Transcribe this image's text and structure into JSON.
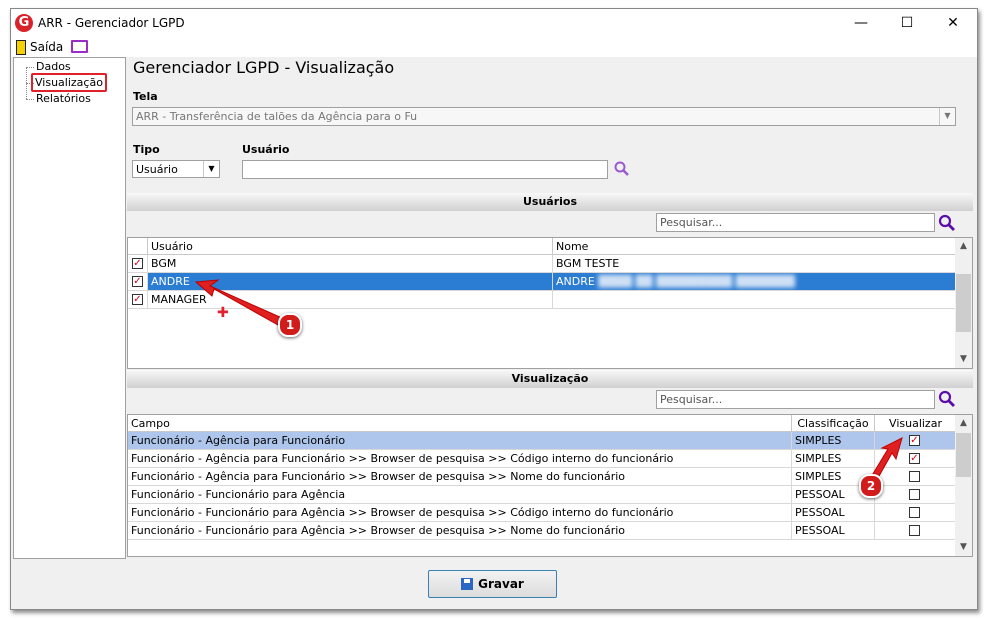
{
  "window": {
    "title": "ARR - Gerenciador LGPD",
    "minimize": "—",
    "maximize": "☐",
    "close": "✕",
    "logo": "G"
  },
  "menu": {
    "exit_label": "Saída"
  },
  "tree": {
    "items": [
      {
        "label": "Dados"
      },
      {
        "label": "Visualização",
        "selected": true
      },
      {
        "label": "Relatórios"
      }
    ]
  },
  "page": {
    "title": "Gerenciador LGPD - Visualização"
  },
  "tela": {
    "label": "Tela",
    "value": "ARR - Transferência de talões da Agência para o Fu"
  },
  "tipo": {
    "label": "Tipo",
    "value": "Usuário"
  },
  "usuario_filter": {
    "label": "Usuário",
    "value": ""
  },
  "usuarios": {
    "header": "Usuários",
    "search_placeholder": "Pesquisar...",
    "columns": [
      "Usuário",
      "Nome"
    ],
    "rows": [
      {
        "checked": true,
        "usuario": "BGM",
        "nome": "BGM TESTE"
      },
      {
        "checked": true,
        "usuario": "ANDRE",
        "nome": "ANDRE",
        "selected": true
      },
      {
        "checked": true,
        "usuario": "MANAGER",
        "nome": ""
      }
    ]
  },
  "visualizacao": {
    "header": "Visualização",
    "search_placeholder": "Pesquisar...",
    "columns": [
      "Campo",
      "Classificação",
      "Visualizar"
    ],
    "rows": [
      {
        "campo": "Funcionário - Agência para Funcionário",
        "classificacao": "SIMPLES",
        "visualizar": true,
        "selected": true
      },
      {
        "campo": "Funcionário - Agência para Funcionário >> Browser de pesquisa >> Código interno do funcionário",
        "classificacao": "SIMPLES",
        "visualizar": true
      },
      {
        "campo": "Funcionário - Agência para Funcionário >> Browser de pesquisa >> Nome do funcionário",
        "classificacao": "SIMPLES",
        "visualizar": false
      },
      {
        "campo": "Funcionário - Funcionário para Agência",
        "classificacao": "PESSOAL",
        "visualizar": false
      },
      {
        "campo": "Funcionário - Funcionário para Agência >> Browser de pesquisa >> Código interno do funcionário",
        "classificacao": "PESSOAL",
        "visualizar": false
      },
      {
        "campo": "Funcionário - Funcionário para Agência >> Browser de pesquisa >> Nome do funcionário",
        "classificacao": "PESSOAL",
        "visualizar": false
      }
    ]
  },
  "actions": {
    "save_label": "Gravar"
  },
  "annotations": {
    "badge1": "1",
    "badge2": "2"
  },
  "colors": {
    "selection": "#2b7cd3",
    "selection_light": "#aec6ec",
    "accent_red": "#d21c1c"
  }
}
